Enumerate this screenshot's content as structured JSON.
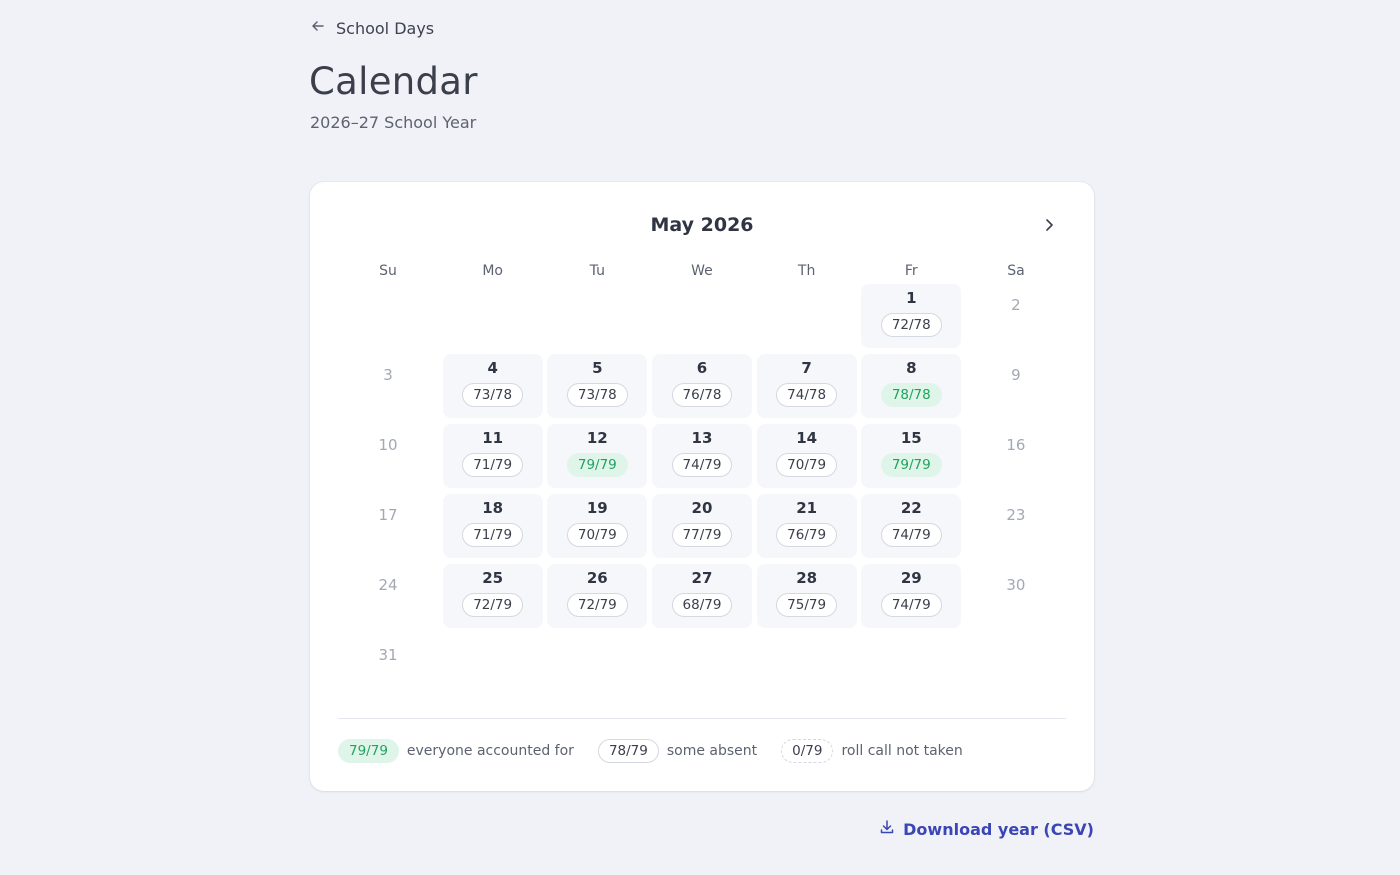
{
  "nav": {
    "back_label": "School Days"
  },
  "header": {
    "title": "Calendar",
    "subtitle": "2026–27 School Year"
  },
  "calendar": {
    "month_label": "May 2026",
    "weekdays": [
      "Su",
      "Mo",
      "Tu",
      "We",
      "Th",
      "Fr",
      "Sa"
    ],
    "leading_blanks": 5,
    "days": [
      {
        "day": "1",
        "count": "72/78",
        "status": "partial"
      },
      {
        "day": "2",
        "count": null,
        "status": "weekend"
      },
      {
        "day": "3",
        "count": null,
        "status": "weekend"
      },
      {
        "day": "4",
        "count": "73/78",
        "status": "partial"
      },
      {
        "day": "5",
        "count": "73/78",
        "status": "partial"
      },
      {
        "day": "6",
        "count": "76/78",
        "status": "partial"
      },
      {
        "day": "7",
        "count": "74/78",
        "status": "partial"
      },
      {
        "day": "8",
        "count": "78/78",
        "status": "full"
      },
      {
        "day": "9",
        "count": null,
        "status": "weekend"
      },
      {
        "day": "10",
        "count": null,
        "status": "weekend"
      },
      {
        "day": "11",
        "count": "71/79",
        "status": "partial"
      },
      {
        "day": "12",
        "count": "79/79",
        "status": "full"
      },
      {
        "day": "13",
        "count": "74/79",
        "status": "partial"
      },
      {
        "day": "14",
        "count": "70/79",
        "status": "partial"
      },
      {
        "day": "15",
        "count": "79/79",
        "status": "full"
      },
      {
        "day": "16",
        "count": null,
        "status": "weekend"
      },
      {
        "day": "17",
        "count": null,
        "status": "weekend"
      },
      {
        "day": "18",
        "count": "71/79",
        "status": "partial"
      },
      {
        "day": "19",
        "count": "70/79",
        "status": "partial"
      },
      {
        "day": "20",
        "count": "77/79",
        "status": "partial"
      },
      {
        "day": "21",
        "count": "76/79",
        "status": "partial"
      },
      {
        "day": "22",
        "count": "74/79",
        "status": "partial"
      },
      {
        "day": "23",
        "count": null,
        "status": "weekend"
      },
      {
        "day": "24",
        "count": null,
        "status": "weekend"
      },
      {
        "day": "25",
        "count": "72/79",
        "status": "partial"
      },
      {
        "day": "26",
        "count": "72/79",
        "status": "partial"
      },
      {
        "day": "27",
        "count": "68/79",
        "status": "partial"
      },
      {
        "day": "28",
        "count": "75/79",
        "status": "partial"
      },
      {
        "day": "29",
        "count": "74/79",
        "status": "partial"
      },
      {
        "day": "30",
        "count": null,
        "status": "weekend"
      },
      {
        "day": "31",
        "count": null,
        "status": "weekend"
      }
    ]
  },
  "legend": [
    {
      "sample": "79/79",
      "label": "everyone accounted for",
      "status": "full"
    },
    {
      "sample": "78/79",
      "label": "some absent",
      "status": "partial"
    },
    {
      "sample": "0/79",
      "label": "roll call not taken",
      "status": "none"
    }
  ],
  "actions": {
    "download_label": "Download year (CSV)"
  },
  "colors": {
    "background": "#f1f2f7",
    "full_bg": "#dff5ea",
    "full_text": "#23a15e",
    "link": "#3a46b5"
  },
  "icons": {
    "back": "arrow-left-icon",
    "next": "chevron-right-icon",
    "download": "download-icon"
  }
}
